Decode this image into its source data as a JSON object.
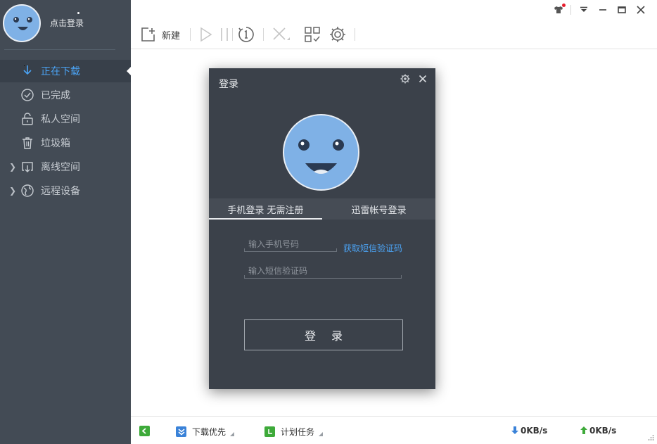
{
  "user": {
    "login_prompt": "点击登录"
  },
  "sidebar": {
    "items": [
      {
        "label": "正在下载",
        "icon": "download-arrow-icon",
        "active": true
      },
      {
        "label": "已完成",
        "icon": "check-circle-icon"
      },
      {
        "label": "私人空间",
        "icon": "lock-icon"
      },
      {
        "label": "垃圾箱",
        "icon": "trash-icon"
      },
      {
        "label": "离线空间",
        "icon": "cloud-download-icon",
        "expandable": true
      },
      {
        "label": "远程设备",
        "icon": "globe-icon",
        "expandable": true
      }
    ]
  },
  "toolbar": {
    "new_label": "新建"
  },
  "dialog": {
    "title": "登录",
    "tabs": [
      {
        "label": "手机登录 无需注册",
        "active": true
      },
      {
        "label": "迅雷帐号登录"
      }
    ],
    "phone_placeholder": "输入手机号码",
    "sms_placeholder": "输入短信验证码",
    "get_sms_link": "获取短信验证码",
    "login_button": "登录"
  },
  "statusbar": {
    "priority_label": "下载优先",
    "schedule_label": "计划任务",
    "download_speed": "0KB/s",
    "upload_speed": "0KB/s"
  },
  "colors": {
    "sidebar_bg": "#434b55",
    "accent_blue": "#4ba3f4",
    "dialog_bg": "#3b414a",
    "avatar_blue": "#7fb1e6",
    "green_icon": "#3eaa3a"
  }
}
